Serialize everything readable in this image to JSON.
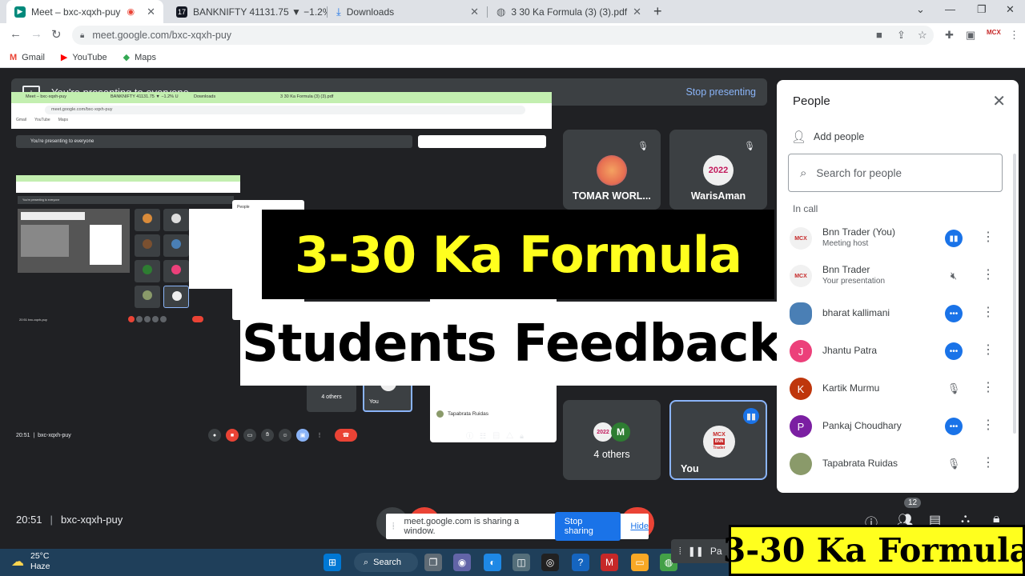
{
  "browser": {
    "tabs": [
      {
        "title": "Meet – bxc-xqxh-puy"
      },
      {
        "title": "BANKNIFTY 41131.75 ▼ −1.2% U"
      },
      {
        "title": "Downloads"
      },
      {
        "title": "3 30 Ka Formula (3) (3).pdf"
      }
    ],
    "url": "meet.google.com/bxc-xqxh-puy",
    "bookmarks": [
      "Gmail",
      "YouTube",
      "Maps"
    ],
    "ext_badge": "MCX"
  },
  "meet": {
    "presenting_text": "You're presenting to everyone",
    "stop_presenting": "Stop presenting",
    "time": "20:51",
    "code": "bxc-xqxh-puy",
    "tiles": [
      {
        "name": "TOMAR WORL..."
      },
      {
        "name": "WarisAman"
      },
      {
        "name": "4 others"
      },
      {
        "name": "You"
      }
    ],
    "you_avatar": {
      "line1": "MCX",
      "line2": "BNN",
      "line3": "Trader"
    },
    "others_avatar": {
      "line1": "2022",
      "line2": "M"
    },
    "waris_avatar": "2022"
  },
  "nested": {
    "tabs": [
      "Meet – bxc-xqxh-puy",
      "BANKNIFTY 41131.75 ▼ −1.2% U",
      "Downloads",
      "3 30 Ka Formula (3) (3).pdf"
    ],
    "url": "meet.google.com/bxc-xqxh-puy",
    "bookmarks": [
      "Gmail",
      "YouTube",
      "Maps"
    ],
    "presenting": "You're presenting to everyone",
    "people_title": "People",
    "tile_names": [
      "4 others",
      "You"
    ],
    "panel_people": [
      "Tapabrata Ruidas"
    ],
    "time": "20:51",
    "code": "bxc-xqxh-puy",
    "inner_bottom": "20:51  bxc-xqxh-puy"
  },
  "overlay": {
    "title": "3-30 Ka Formula",
    "subtitle": "Students Feedback",
    "corner": "3-30 Ka Formula"
  },
  "people_panel": {
    "title": "People",
    "add_people": "Add people",
    "search_placeholder": "Search for people",
    "section": "In call",
    "people": [
      {
        "name": "Bnn Trader (You)",
        "sub": "Meeting host",
        "avatar": "MCX",
        "color": "#ffffff",
        "mic": "active"
      },
      {
        "name": "Bnn Trader",
        "sub": "Your presentation",
        "avatar": "MCX",
        "color": "#ffffff",
        "mic": "muted"
      },
      {
        "name": "bharat kallimani",
        "sub": "",
        "avatar": "",
        "color": "#4a7fb5",
        "mic": "more"
      },
      {
        "name": "Jhantu Patra",
        "sub": "",
        "avatar": "J",
        "color": "#ec407a",
        "mic": "more"
      },
      {
        "name": "Kartik Murmu",
        "sub": "",
        "avatar": "K",
        "color": "#bf360c",
        "mic": "muted"
      },
      {
        "name": "Pankaj Choudhary",
        "sub": "",
        "avatar": "P",
        "color": "#7b1fa2",
        "mic": "more"
      },
      {
        "name": "Tapabrata Ruidas",
        "sub": "",
        "avatar": "",
        "color": "#8a9a6a",
        "mic": "muted"
      }
    ],
    "participant_count": "12"
  },
  "share_bar": {
    "text": "meet.google.com is sharing a window.",
    "stop": "Stop sharing",
    "hide": "Hide"
  },
  "pause_label": "Pa",
  "taskbar": {
    "temp": "25°C",
    "condition": "Haze",
    "search": "Search"
  },
  "colors": {
    "accent": "#1a73e8",
    "meet_bg": "#202124",
    "end_call": "#ea4335",
    "overlay_yellow": "#ffff1e"
  }
}
